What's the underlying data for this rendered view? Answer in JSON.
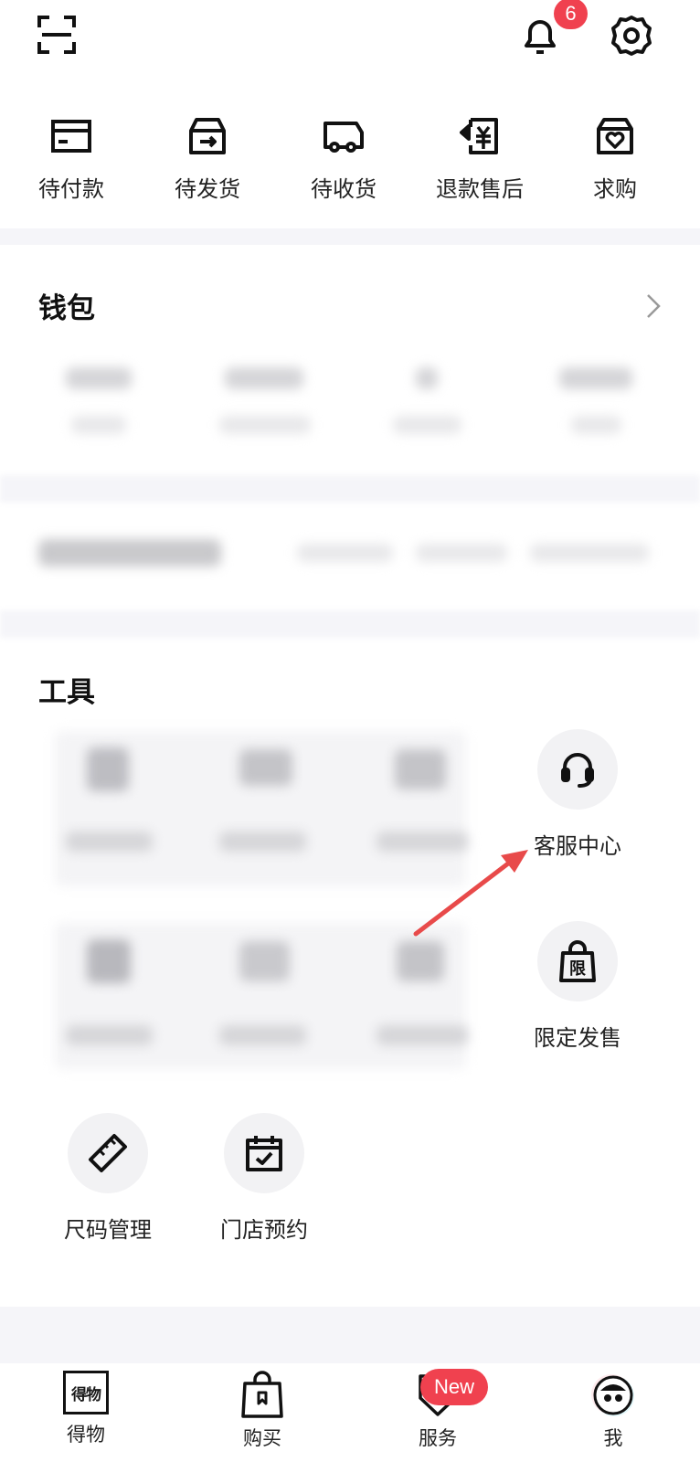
{
  "header": {
    "scan_icon": "scan-icon",
    "bell_icon": "bell-icon",
    "notification_count": "6",
    "settings_icon": "gear-icon"
  },
  "orders": {
    "items": [
      {
        "label": "待付款",
        "icon": "card-icon"
      },
      {
        "label": "待发货",
        "icon": "box-send-icon"
      },
      {
        "label": "待收货",
        "icon": "truck-icon"
      },
      {
        "label": "退款售后",
        "icon": "refund-icon"
      },
      {
        "label": "求购",
        "icon": "heart-bag-icon"
      }
    ]
  },
  "wallet": {
    "title": "钱包",
    "chevron_icon": "chevron-right-icon"
  },
  "tools": {
    "title": "工具",
    "items": [
      {
        "label": "客服中心",
        "icon": "headset-icon"
      },
      {
        "label": "限定发售",
        "icon": "limited-bag-icon",
        "icon_text": "限"
      },
      {
        "label": "尺码管理",
        "icon": "ruler-icon"
      },
      {
        "label": "门店预约",
        "icon": "calendar-check-icon"
      }
    ]
  },
  "bottom_nav": {
    "items": [
      {
        "label": "得物",
        "icon": "dewu-logo-icon",
        "icon_text": "得物"
      },
      {
        "label": "购买",
        "icon": "shopping-bag-icon"
      },
      {
        "label": "服务",
        "icon": "service-shield-icon"
      },
      {
        "label": "我",
        "icon": "avatar-icon"
      }
    ],
    "new_badge": "New"
  },
  "colors": {
    "accent_red": "#f0414f",
    "annotation_arrow": "#e84a4a",
    "separator": "#f5f5f9",
    "icon_circle": "#f2f2f4"
  }
}
